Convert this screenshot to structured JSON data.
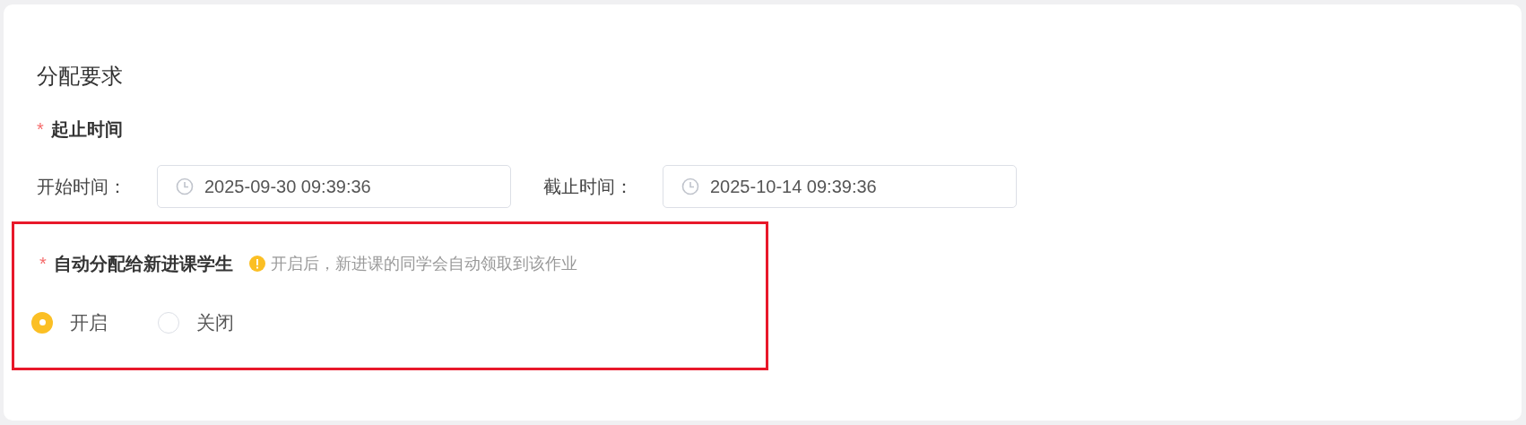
{
  "section_title": "分配要求",
  "period": {
    "label": "起止时间",
    "required_mark": "*",
    "fields": [
      {
        "label": "开始时间：",
        "value": "2025-09-30 09:39:36"
      },
      {
        "label": "截止时间：",
        "value": "2025-10-14 09:39:36"
      }
    ]
  },
  "auto_assign": {
    "label": "自动分配给新进课学生",
    "required_mark": "*",
    "hint": "开启后，新进课的同学会自动领取到该作业",
    "highlighted": true,
    "options": [
      {
        "label": "开启",
        "selected": true
      },
      {
        "label": "关闭",
        "selected": false
      }
    ]
  }
}
